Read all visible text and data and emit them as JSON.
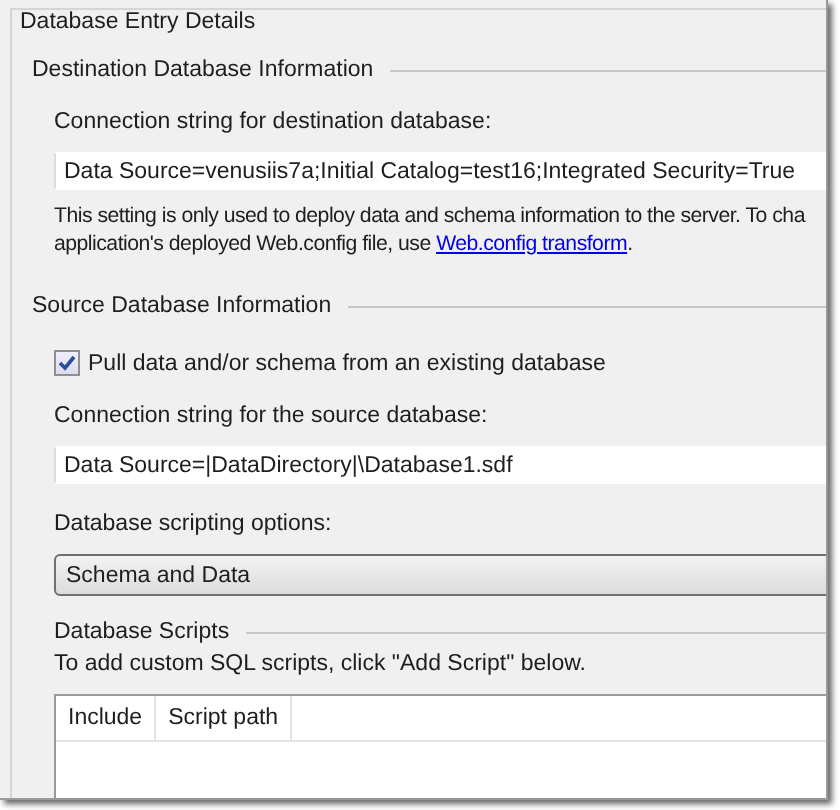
{
  "group_title": "Database Entry Details",
  "destination": {
    "title": "Destination Database Information",
    "connection_label": "Connection string for destination database:",
    "connection_value": "Data Source=venusiis7a;Initial Catalog=test16;Integrated Security=True",
    "help_line_1": "This setting is only used to deploy data and schema information to the server. To cha",
    "help_line_2_before": "application's deployed Web.config file, use ",
    "help_link": "Web.config transform",
    "help_line_2_after": "."
  },
  "source": {
    "title": "Source Database Information",
    "pull_checkbox": {
      "label": "Pull data and/or schema from an existing database",
      "checked": true
    },
    "connection_label": "Connection string for the source database:",
    "connection_value": "Data Source=|DataDirectory|\\Database1.sdf",
    "scripting_label": "Database scripting options:",
    "scripting_value": "Schema and Data"
  },
  "scripts": {
    "title": "Database Scripts",
    "hint": "To add custom SQL scripts, click \"Add Script\" below.",
    "columns": [
      "Include",
      "Script path"
    ]
  }
}
